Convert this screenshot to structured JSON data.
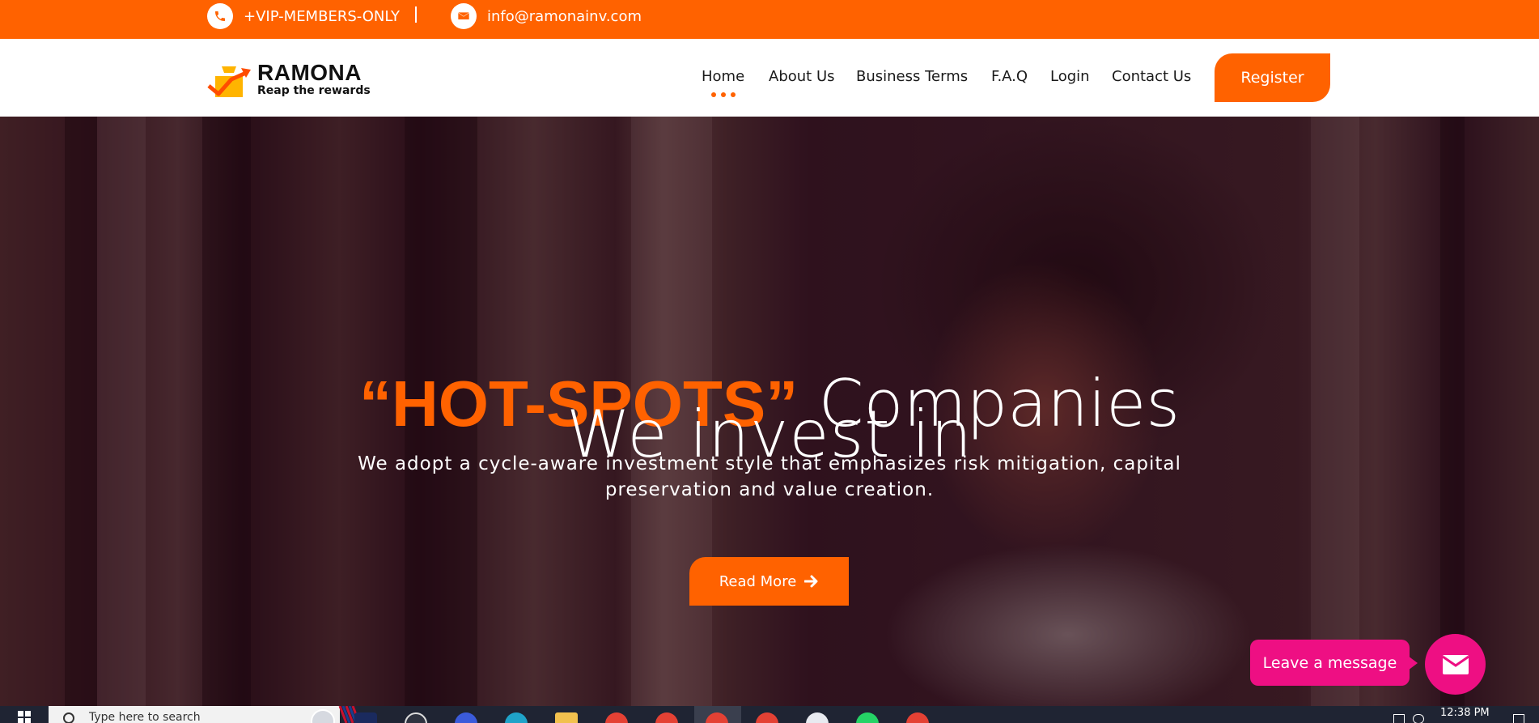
{
  "topbar": {
    "phone_icon": "phone-icon",
    "phone_text": "+VIP-MEMBERS-ONLY",
    "email_icon": "envelope-icon",
    "email_text": "info@ramonainv.com",
    "background": "#ff6200"
  },
  "brand": {
    "name": "RAMONA",
    "tagline": "Reap the rewards",
    "logo_icon": "growth-chart-logo-icon"
  },
  "nav": {
    "items": [
      {
        "label": "Home",
        "active": true
      },
      {
        "label": "About Us"
      },
      {
        "label": "Business Terms"
      },
      {
        "label": "F.A.Q"
      },
      {
        "label": "Login"
      },
      {
        "label": "Contact Us"
      }
    ],
    "register_label": "Register"
  },
  "hero": {
    "line1": "We invest in",
    "highlight": "“HOT-SPOTS”",
    "line2_rest": "Companies",
    "subtitle": "We adopt a cycle-aware investment style that emphasizes risk mitigation, capital preservation and value creation.",
    "cta_label": "Read More",
    "cta_icon": "arrow-right-icon"
  },
  "chat": {
    "label": "Leave a message",
    "icon": "mail-icon",
    "color": "#ee0f83"
  },
  "taskbar": {
    "search_placeholder": "Type here to search",
    "clock": "12:38 PM"
  },
  "colors": {
    "accent": "#ff6200",
    "chat": "#ee0f83"
  }
}
